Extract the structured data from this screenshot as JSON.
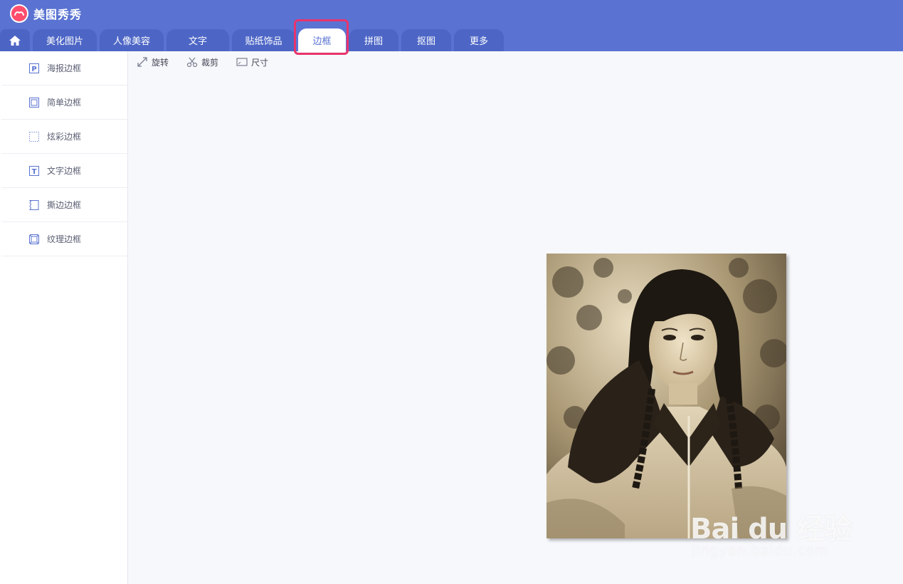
{
  "app": {
    "title": "美图秀秀",
    "logo_icon": "meitu-logo-icon",
    "accent_color": "#5a73d2",
    "highlight_color": "#e8336b"
  },
  "tabs": {
    "home_icon": "home-icon",
    "items": [
      {
        "label": "美化图片"
      },
      {
        "label": "人像美容"
      },
      {
        "label": "文字"
      },
      {
        "label": "贴纸饰品"
      },
      {
        "label": "边框",
        "active": true
      },
      {
        "label": "拼图"
      },
      {
        "label": "抠图"
      },
      {
        "label": "更多"
      }
    ]
  },
  "sidebar": {
    "items": [
      {
        "label": "海报边框",
        "icon": "poster-frame-icon"
      },
      {
        "label": "简单边框",
        "icon": "simple-frame-icon"
      },
      {
        "label": "炫彩边框",
        "icon": "colorful-frame-icon"
      },
      {
        "label": "文字边框",
        "icon": "text-frame-icon"
      },
      {
        "label": "撕边边框",
        "icon": "torn-edge-frame-icon"
      },
      {
        "label": "纹理边框",
        "icon": "texture-frame-icon"
      }
    ]
  },
  "toolbar": {
    "rotate_label": "旋转",
    "crop_label": "裁剪",
    "size_label": "尺寸"
  },
  "canvas": {
    "photo_alt": "sepia portrait photo"
  },
  "watermark": {
    "line1": "Bai du 经验",
    "line2": "jingyan.baidu.com"
  }
}
